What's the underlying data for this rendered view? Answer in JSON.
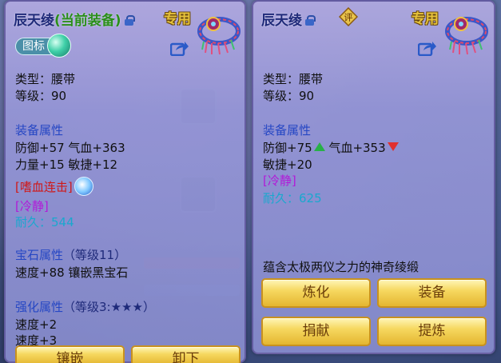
{
  "left": {
    "name": "辰天绫",
    "equipped_tag": "(当前装备)",
    "exclusive": "专用",
    "badge": "图标",
    "type_line": "类型：腰带",
    "level_line": "等级：90",
    "attr_header": "装备属性",
    "attr_line1": "防御+57 气血+363",
    "attr_line2": "力量+15 敏捷+12",
    "special_skill": "[嗜血连击]",
    "special_effect": "[冷静]",
    "durability": "耐久：544",
    "gem_header": "宝石属性",
    "gem_level": "（等级11）",
    "gem_line": "速度+88 镶嵌黑宝石",
    "enhance_header": "强化属性",
    "enhance_level": "（等级3:★★★）",
    "enhance_line1": "速度+2",
    "enhance_line2": "速度+3",
    "btn_inlay": "镶嵌",
    "btn_unequip": "卸下"
  },
  "right": {
    "name": "辰天绫",
    "exclusive": "专用",
    "ping": "评",
    "type_line": "类型：腰带",
    "level_line": "等级：90",
    "attr_header": "装备属性",
    "defense": "防御+75",
    "hp": "气血+353",
    "agility": "敏捷+20",
    "special_effect": "[冷静]",
    "durability": "耐久：625",
    "description": "蕴含太极两仪之力的神奇绫缎",
    "btn_refine": "炼化",
    "btn_equip": "装备",
    "btn_donate": "捐献",
    "btn_extract": "提炼"
  },
  "colors": {
    "header_blue": "#2647c4",
    "equipped_green": "#2a8f1a",
    "exclusive_gold": "#e6c23a",
    "skill_red": "#d01818",
    "effect_purple": "#b21ad8",
    "durability_cyan": "#1aa8ce",
    "stat_up": "#28b048",
    "stat_down": "#e03030"
  },
  "icons": [
    "lock-icon",
    "item-belt-icon",
    "share-icon",
    "badge-orb-icon",
    "skill-icon",
    "rating-icon",
    "arrow-up-icon",
    "arrow-down-icon"
  ]
}
